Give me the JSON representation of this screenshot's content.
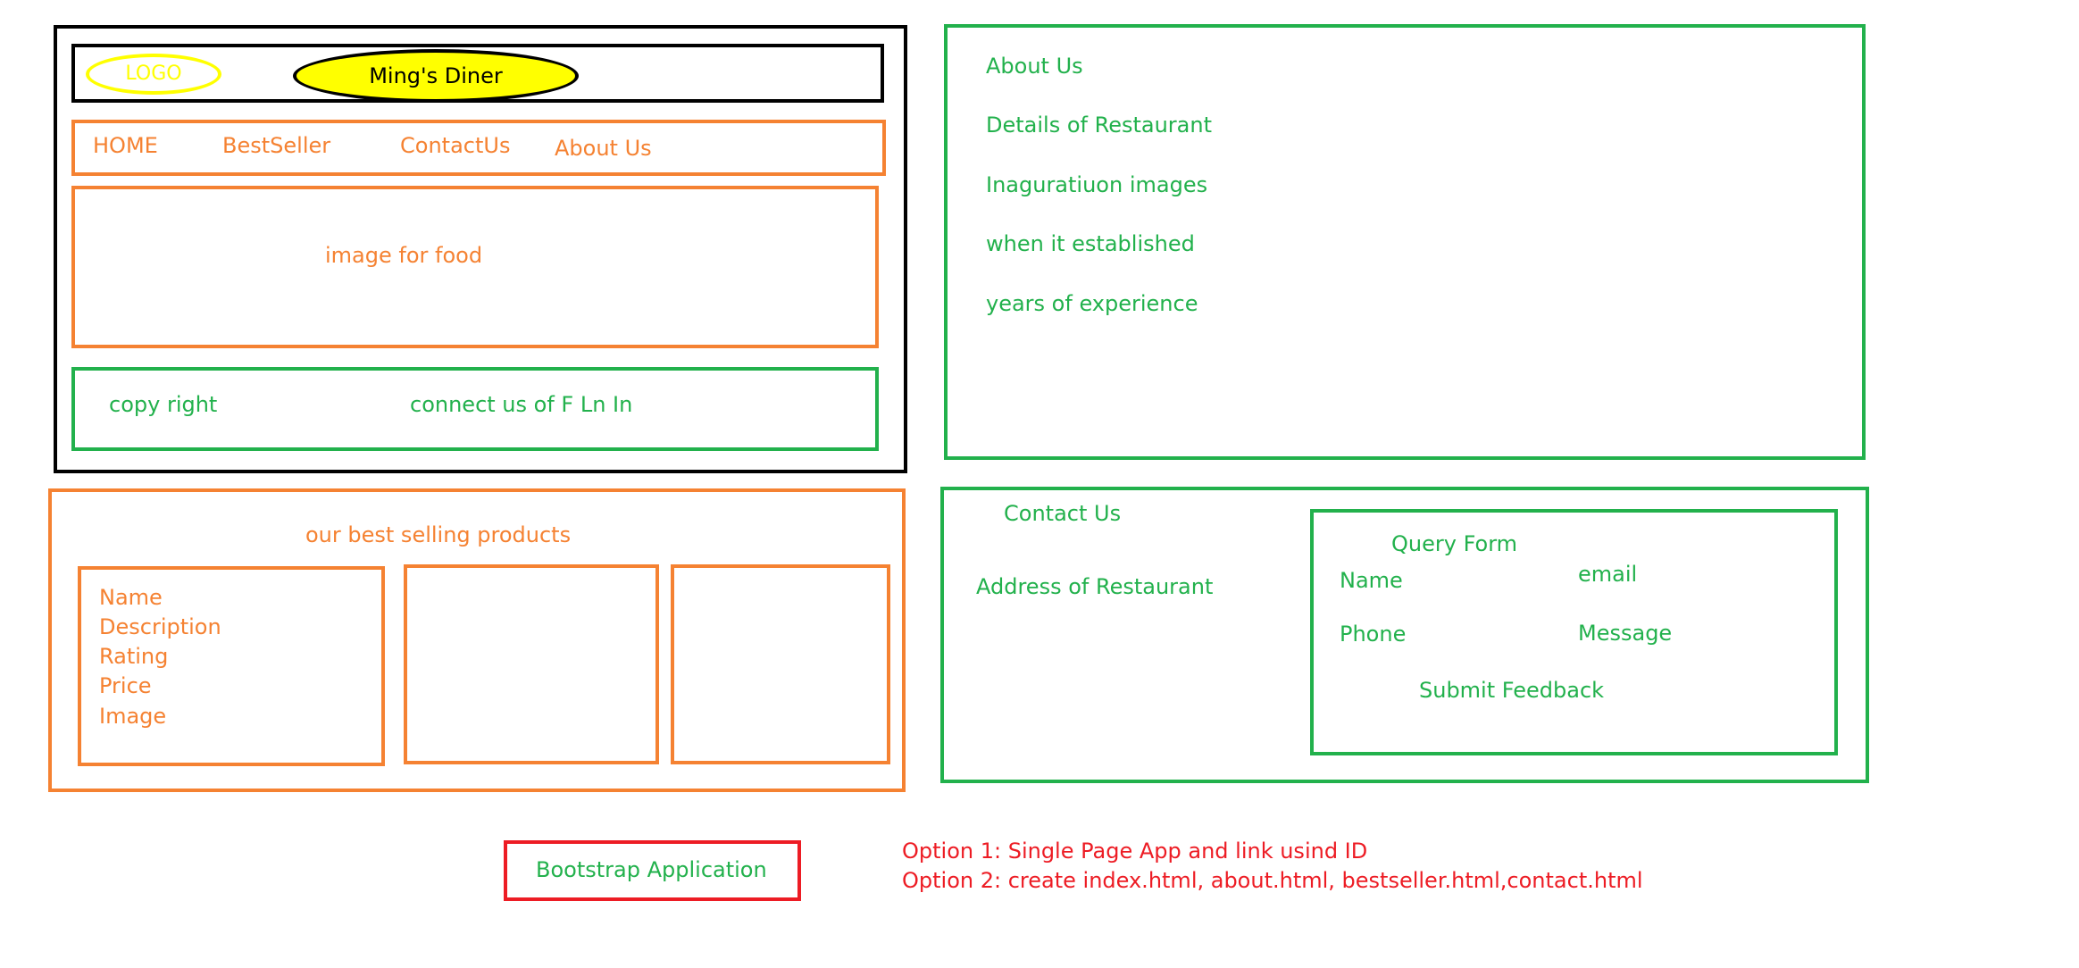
{
  "header": {
    "logo": "LOGO",
    "title": "Ming's Diner"
  },
  "nav": {
    "items": [
      {
        "label": "HOME"
      },
      {
        "label": "BestSeller"
      },
      {
        "label": "ContactUs"
      },
      {
        "label": "About Us"
      }
    ]
  },
  "hero": {
    "label": "image for food"
  },
  "footer": {
    "copyright": "copy right",
    "social": "connect us of F Ln  In"
  },
  "about": {
    "items": [
      {
        "label": "About Us"
      },
      {
        "label": "Details of Restaurant"
      },
      {
        "label": "Inaguratiuon images"
      },
      {
        "label": "when it established"
      },
      {
        "label": "years of experience"
      }
    ]
  },
  "bestseller": {
    "title": "our best selling products",
    "card_fields": [
      "Name",
      "Description",
      "Rating",
      "Price",
      "Image"
    ]
  },
  "contact": {
    "title": "Contact Us",
    "address": "Address of Restaurant",
    "form": {
      "title": "Query Form",
      "name": "Name",
      "email": "email",
      "phone": "Phone",
      "message": "Message",
      "submit": "Submit Feedback"
    }
  },
  "app_label": "Bootstrap Application",
  "options": [
    "Option 1: Single Page App and link usind ID",
    "Option 2: create index.html, about.html, bestseller.html,contact.html"
  ],
  "colors": {
    "black": "#000000",
    "orange": "#f58232",
    "green": "#22b14c",
    "red": "#ed1c24",
    "yellow": "#ffff00"
  }
}
